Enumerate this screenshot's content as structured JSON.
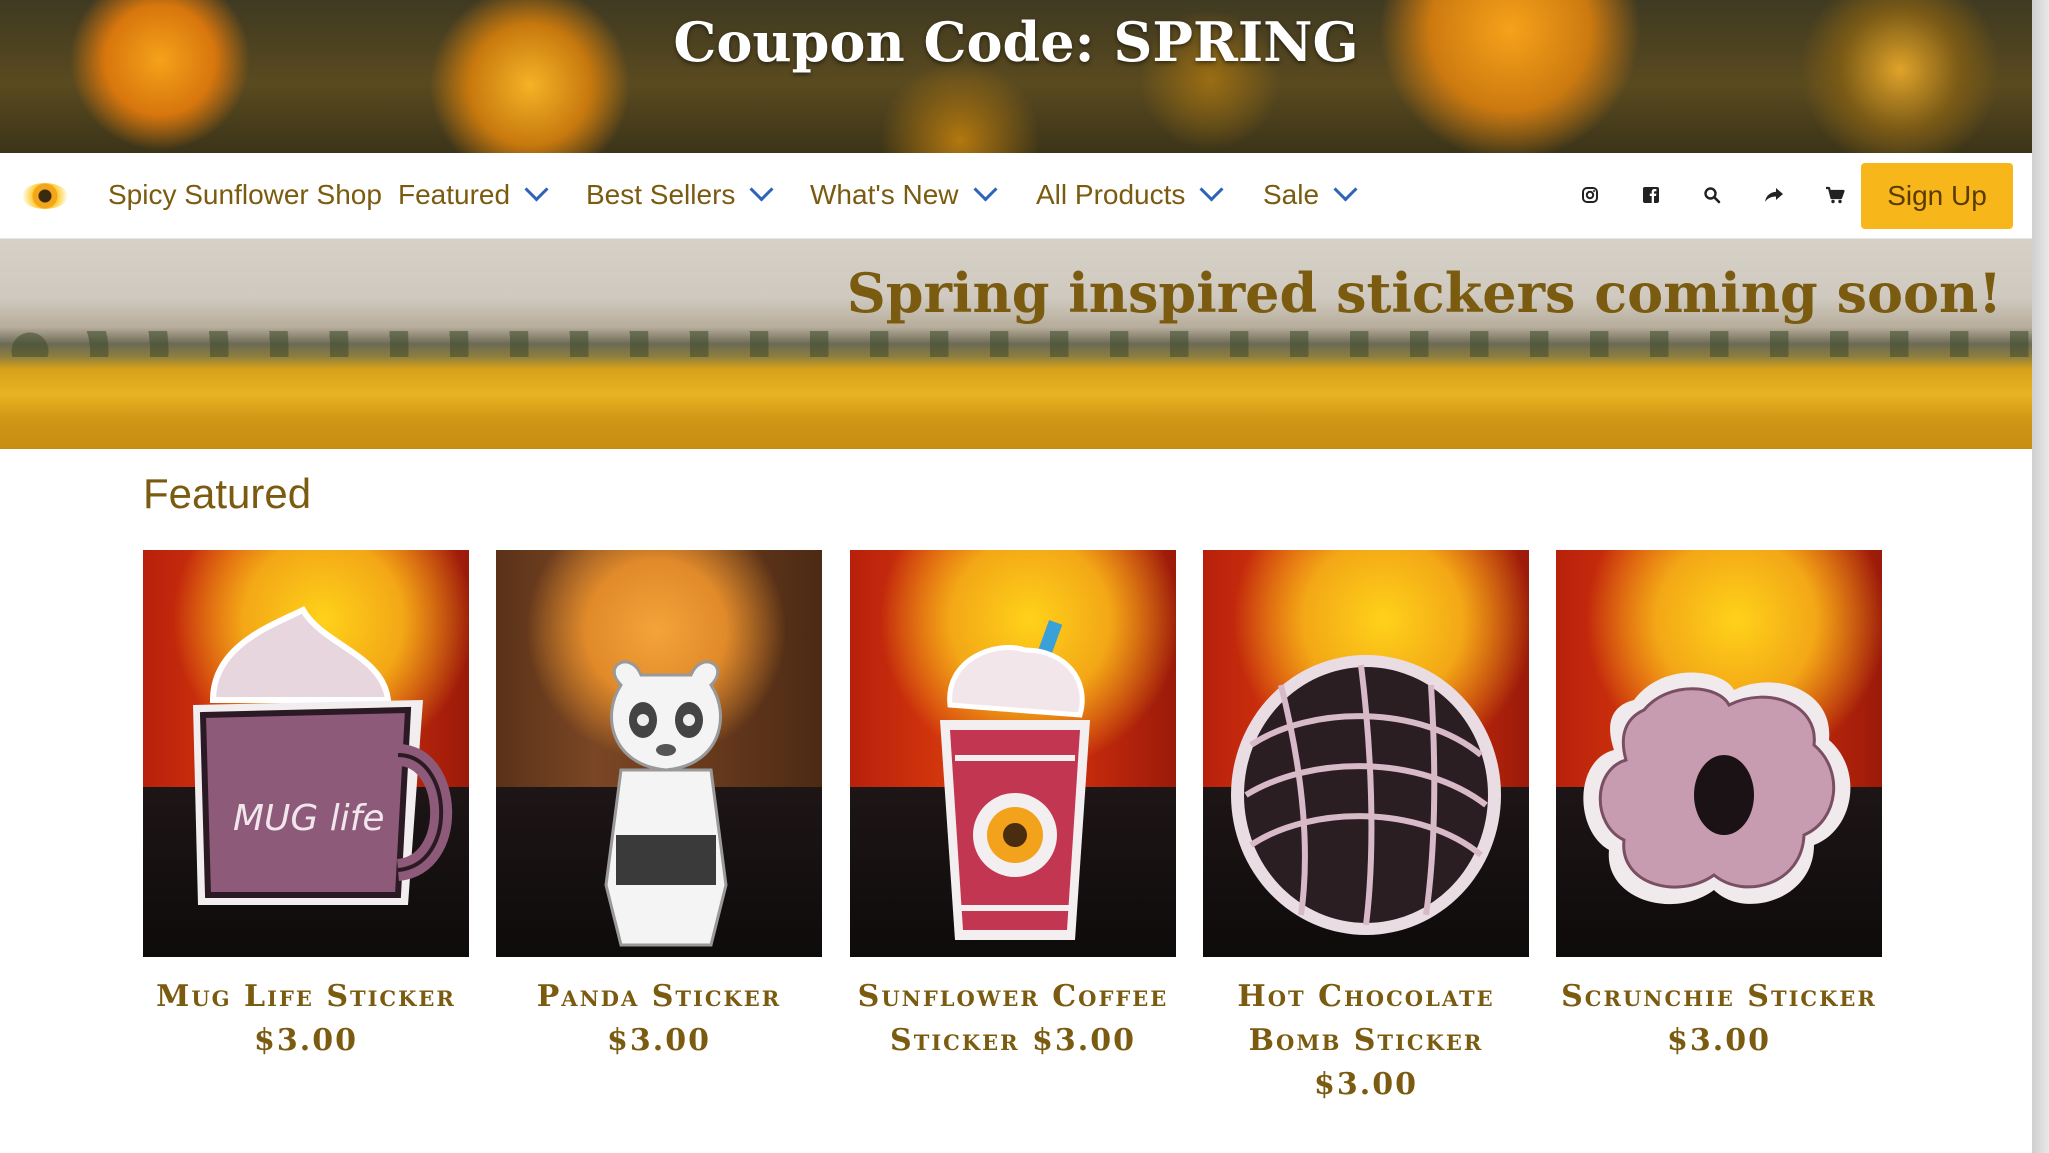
{
  "coupon": {
    "text": "Coupon Code: SPRING"
  },
  "nav": {
    "brand": "Spicy Sunflower Shop",
    "items": [
      "Featured",
      "Best Sellers",
      "What's New",
      "All Products",
      "Sale"
    ],
    "icons": [
      "instagram-icon",
      "facebook-icon",
      "search-icon",
      "share-icon",
      "cart-icon"
    ],
    "signup_label": "Sign Up"
  },
  "hero": {
    "text": "Spring inspired stickers coming soon!"
  },
  "featured": {
    "title": "Featured",
    "products": [
      {
        "title": "Mug Life Sticker $3.00",
        "sticker_text": "MUG life"
      },
      {
        "title": "Panda Sticker $3.00"
      },
      {
        "title": "Sunflower Coffee Sticker $3.00"
      },
      {
        "title": "Hot Chocolate Bomb Sticker $3.00"
      },
      {
        "title": "Scrunchie Sticker $3.00"
      }
    ]
  },
  "colors": {
    "accent_gold": "#7a5b10",
    "signup_bg": "#f7b71a",
    "chevron_blue": "#2d63b8"
  }
}
